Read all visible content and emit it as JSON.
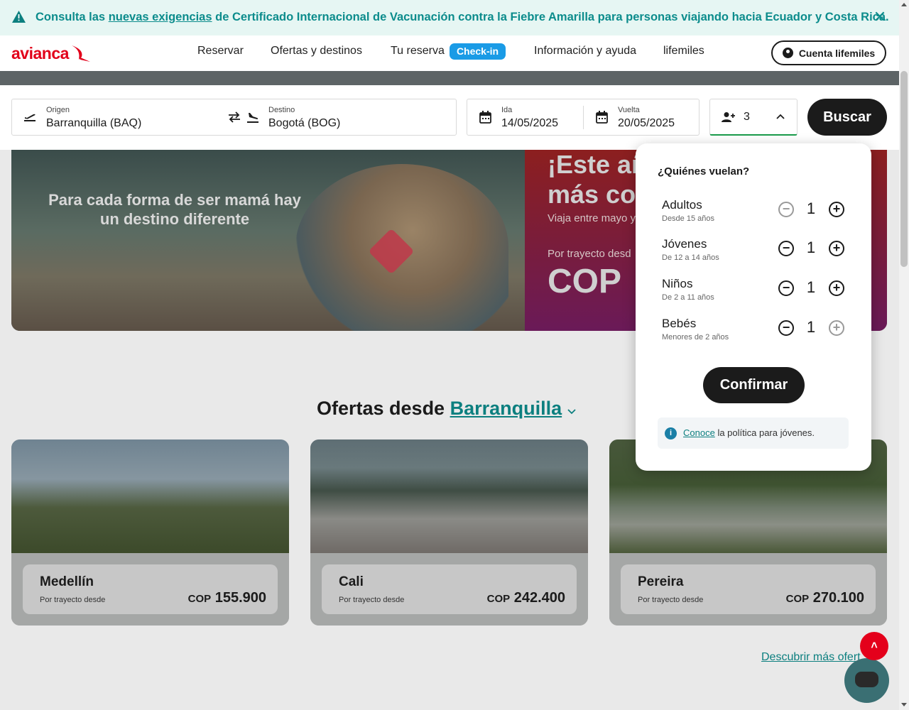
{
  "alert": {
    "prefix": "Consulta las",
    "link": "nuevas exigencias",
    "suffix": "de Certificado Internacional de Vacunación contra la Fiebre Amarilla para personas viajando hacia Ecuador y Costa Rica."
  },
  "header": {
    "logo": "avianca",
    "nav": [
      "Reservar",
      "Ofertas y destinos",
      "Tu reserva",
      "Información y ayuda",
      "lifemiles"
    ],
    "checkin": "Check-in",
    "account": "Cuenta lifemiles"
  },
  "search": {
    "origin_label": "Origen",
    "origin_value": "Barranquilla  (BAQ)",
    "destination_label": "Destino",
    "destination_value": "Bogotá  (BOG)",
    "depart_label": "Ida",
    "depart_value": "14/05/2025",
    "return_label": "Vuelta",
    "return_value": "20/05/2025",
    "passengers": "3",
    "search_button": "Buscar"
  },
  "hero": {
    "tagline": "Para cada forma de ser mamá hay un destino diferente",
    "title_line1": "¡Este añ",
    "title_line2": "más co",
    "subtitle": "Viaja entre mayo y",
    "from": "Por trayecto desd",
    "price": "COP"
  },
  "passenger_popup": {
    "title": "¿Quiénes vuelan?",
    "rows": [
      {
        "name": "Adultos",
        "desc": "Desde 15 años",
        "count": "1"
      },
      {
        "name": "Jóvenes",
        "desc": "De 12 a 14 años",
        "count": "1"
      },
      {
        "name": "Niños",
        "desc": "De 2 a 11 años",
        "count": "1"
      },
      {
        "name": "Bebés",
        "desc": "Menores de 2 años",
        "count": "1"
      }
    ],
    "confirm": "Confirmar",
    "policy_link": "Conoce",
    "policy_text": "la política para jóvenes."
  },
  "offers": {
    "title_prefix": "Ofertas desde",
    "city": "Barranquilla",
    "cards": [
      {
        "city": "Medellín",
        "from": "Por trayecto desde",
        "currency": "COP",
        "price": "155.900"
      },
      {
        "city": "Cali",
        "from": "Por trayecto desde",
        "currency": "COP",
        "price": "242.400"
      },
      {
        "city": "Pereira",
        "from": "Por trayecto desde",
        "currency": "COP",
        "price": "270.100"
      }
    ],
    "more_link": "Descubrir más ofert"
  },
  "colors": {
    "brand_red": "#e2001a",
    "teal": "#0c8c8c",
    "checkin_blue": "#1a9be6",
    "dark": "#1b1b1b"
  },
  "icons": [
    "warning-icon",
    "close-icon",
    "user-icon",
    "takeoff-icon",
    "swap-icon",
    "landing-icon",
    "calendar-icon",
    "add-person-icon",
    "chevron-up-icon",
    "minus-icon",
    "plus-icon",
    "info-icon",
    "arrow-up-icon",
    "chat-icon",
    "chevron-down-icon"
  ]
}
